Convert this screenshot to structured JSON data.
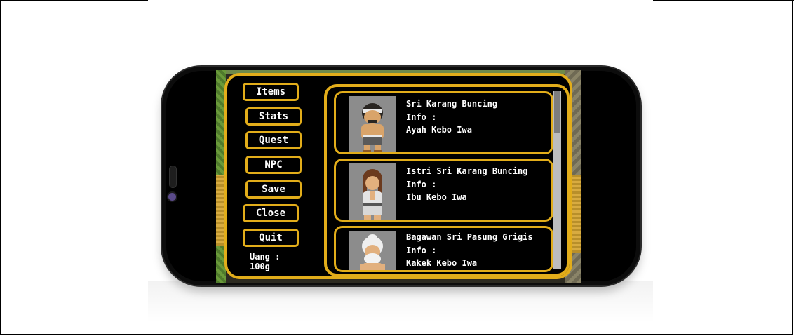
{
  "menu": {
    "items": [
      {
        "label": "Items"
      },
      {
        "label": "Stats"
      },
      {
        "label": "Quest"
      },
      {
        "label": "NPC"
      },
      {
        "label": "Save"
      },
      {
        "label": "Close"
      },
      {
        "label": "Quit"
      }
    ],
    "money_label": "Uang :",
    "money_value": "100g"
  },
  "npc_list": [
    {
      "name": "Sri Karang Buncing",
      "info_label": "Info :",
      "info": "Ayah Kebo Iwa",
      "icon": "father-portrait-icon"
    },
    {
      "name": "Istri Sri Karang Buncing",
      "info_label": "Info :",
      "info": "Ibu Kebo Iwa",
      "icon": "mother-portrait-icon"
    },
    {
      "name": "Bagawan Sri Pasung Grigis",
      "info_label": "Info :",
      "info": "Kakek Kebo Iwa",
      "icon": "elder-portrait-icon"
    }
  ],
  "colors": {
    "accent": "#e2ad1a",
    "panel": "#000000",
    "text": "#ffffff"
  }
}
